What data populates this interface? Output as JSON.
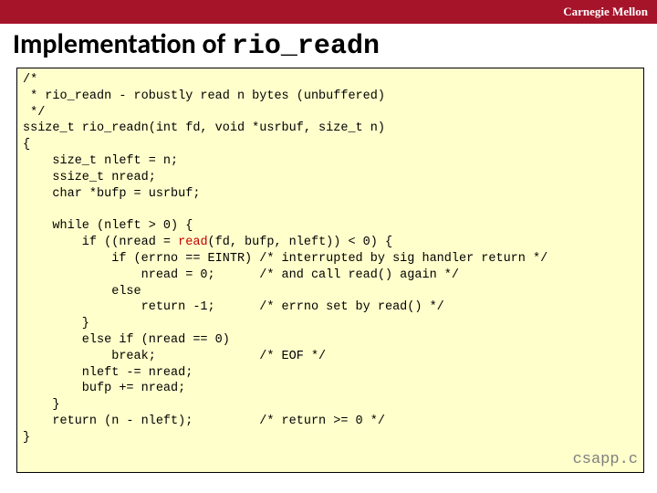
{
  "header": {
    "university": "Carnegie Mellon"
  },
  "title": {
    "prefix": "Implementation of ",
    "func": "rio_readn"
  },
  "code": {
    "l1": "/*",
    "l2": " * rio_readn - robustly read n bytes (unbuffered)",
    "l3": " */",
    "l4": "ssize_t rio_readn(int fd, void *usrbuf, size_t n)",
    "l5": "{",
    "l6": "    size_t nleft = n;",
    "l7": "    ssize_t nread;",
    "l8": "    char *bufp = usrbuf;",
    "l9": "",
    "l10": "    while (nleft > 0) {",
    "l11a": "        if ((nread = ",
    "l11b": "read",
    "l11c": "(fd, bufp, nleft)) < 0) {",
    "l12": "            if (errno == EINTR) /* interrupted by sig handler return */",
    "l13": "                nread = 0;      /* and call read() again */",
    "l14": "            else",
    "l15": "                return -1;      /* errno set by read() */",
    "l16": "        }",
    "l17": "        else if (nread == 0)",
    "l18": "            break;              /* EOF */",
    "l19": "        nleft -= nread;",
    "l20": "        bufp += nread;",
    "l21": "    }",
    "l22": "    return (n - nleft);         /* return >= 0 */",
    "l23": "}"
  },
  "file": "csapp.c"
}
